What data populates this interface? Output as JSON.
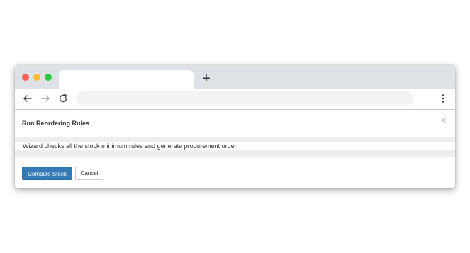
{
  "browser": {
    "new_tab_label": "+",
    "address_value": ""
  },
  "dialog": {
    "title": "Run Reordering Rules",
    "close_symbol": "×",
    "message": "Wizard checks all the stock minimum rules and generate procurement order.",
    "primary_button": "Compute Stock",
    "secondary_button": "Cancel"
  },
  "colors": {
    "primary": "#337ab7",
    "tabbar": "#dee1e6"
  }
}
